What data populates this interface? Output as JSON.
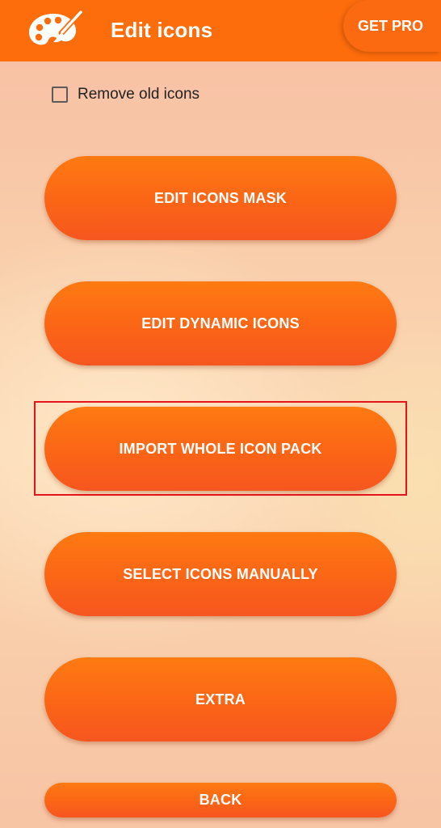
{
  "header": {
    "title": "Edit icons",
    "get_pro_label": "GET PRO",
    "logo_icon": "palette-icon"
  },
  "options": {
    "remove_old_icons_label": "Remove old icons",
    "remove_old_icons_checked": false
  },
  "menu": {
    "edit_icons_mask": "EDIT ICONS MASK",
    "edit_dynamic_icons": "EDIT DYNAMIC ICONS",
    "import_whole_icon_pack": "IMPORT WHOLE ICON PACK",
    "select_icons_manually": "SELECT ICONS MANUALLY",
    "extra": "EXTRA",
    "back": "BACK"
  },
  "colors": {
    "accent": "#fd6d0c",
    "button": "#fb6516",
    "highlight": "#e3141c"
  }
}
